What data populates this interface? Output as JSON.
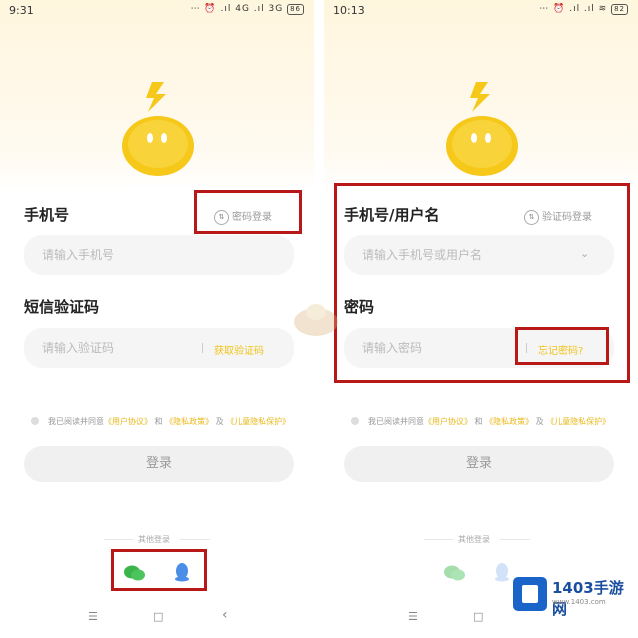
{
  "left_screen": {
    "status_bar": {
      "time": "9:31",
      "icons": "⋯ ⏰ .ıl 4G .ıl 3G",
      "battery": "86"
    },
    "phone_label": "手机号",
    "switch_login": "密码登录",
    "phone_placeholder": "请输入手机号",
    "code_label": "短信验证码",
    "code_placeholder": "请输入验证码",
    "get_code": "获取验证码",
    "agreement": {
      "prefix": "我已阅读并同意",
      "link1": "《用户协议》",
      "sep1": "和",
      "link2": "《隐私政策》",
      "sep2": "及",
      "link3": "《儿童隐私保护》"
    },
    "login_button": "登录",
    "third_party_title": "其他登录"
  },
  "right_screen": {
    "status_bar": {
      "time": "10:13",
      "icons": "⋯ ⏰ .ıl .ıl ≋",
      "battery": "82"
    },
    "account_label": "手机号/用户名",
    "switch_login": "验证码登录",
    "account_placeholder": "请输入手机号或用户名",
    "password_label": "密码",
    "password_placeholder": "请输入密码",
    "forgot_password": "忘记密码?",
    "agreement": {
      "prefix": "我已阅读并同意",
      "link1": "《用户协议》",
      "sep1": "和",
      "link2": "《隐私政策》",
      "sep2": "及",
      "link3": "《儿童隐私保护》"
    },
    "login_button": "登录",
    "third_party_title": "其他登录"
  },
  "nav": {
    "menu": "☰",
    "home": "□",
    "back": "‹"
  },
  "watermark": {
    "site_name": "1403手游网",
    "url": "www.1403.com"
  },
  "colors": {
    "accent": "#f0c419",
    "highlight_box": "#b81818",
    "mascot": "#f5c81a",
    "wechat": "#39b54a",
    "qq": "#4a8ee8"
  }
}
